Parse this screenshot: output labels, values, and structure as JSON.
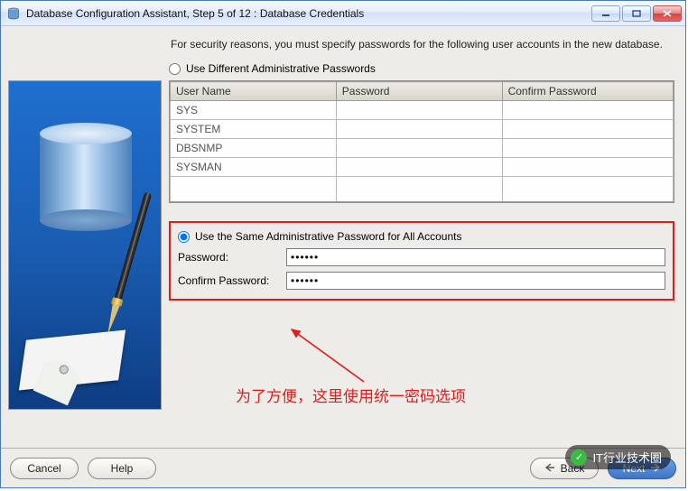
{
  "window": {
    "title": "Database Configuration Assistant, Step 5 of 12 : Database Credentials"
  },
  "intro": "For security reasons, you must specify passwords for the following user accounts in the new database.",
  "option_different": {
    "label": "Use Different Administrative Passwords",
    "selected": false
  },
  "grid": {
    "headers": {
      "user": "User Name",
      "password": "Password",
      "confirm": "Confirm Password"
    },
    "rows": [
      {
        "user": "SYS",
        "password": "",
        "confirm": ""
      },
      {
        "user": "SYSTEM",
        "password": "",
        "confirm": ""
      },
      {
        "user": "DBSNMP",
        "password": "",
        "confirm": ""
      },
      {
        "user": "SYSMAN",
        "password": "",
        "confirm": ""
      }
    ]
  },
  "option_same": {
    "label": "Use the Same Administrative Password for All Accounts",
    "selected": true,
    "password_label": "Password:",
    "confirm_label": "Confirm Password:",
    "password_value": "******",
    "confirm_value": "******"
  },
  "annotation": "为了方便，这里使用统一密码选项",
  "buttons": {
    "cancel": "Cancel",
    "help": "Help",
    "back": "Back",
    "next": "Next"
  },
  "watermark": "IT行业技术圈"
}
